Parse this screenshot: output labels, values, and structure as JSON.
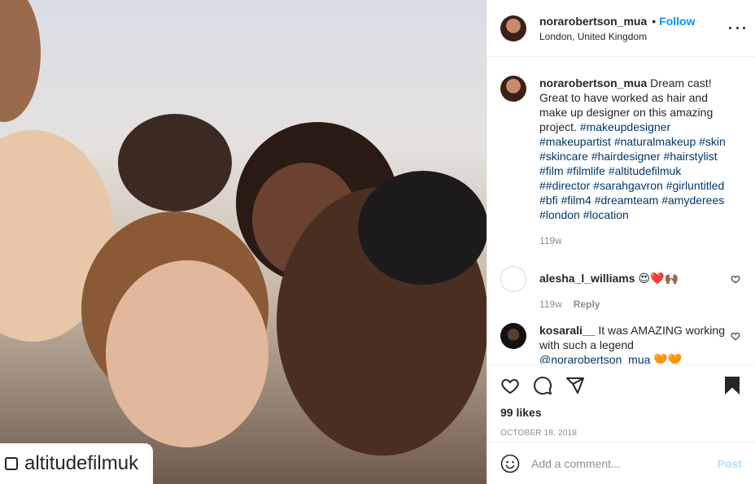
{
  "photo": {
    "repost_label": "altitudefilmuk"
  },
  "header": {
    "username": "norarobertson_mua",
    "separator": "•",
    "follow_label": "Follow",
    "location": "London, United Kingdom"
  },
  "caption": {
    "username": "norarobertson_mua",
    "text_intro": "Dream cast! Great to have worked as hair and make up designer on this amazing project.",
    "hashtags": [
      "#makeupdesigner",
      "#makeupartist",
      "#naturalmakeup",
      "#skin",
      "#skincare",
      "#hairdesigner",
      "#hairstylist",
      "#film",
      "#filmlife",
      "#altitudefilmuk",
      "##director",
      "#sarahgavron",
      "#girluntitled",
      "#bfi",
      "#film4",
      "#dreamteam",
      "#amyderees",
      "#london",
      "#location"
    ],
    "time": "119w"
  },
  "comments": [
    {
      "username": "alesha_l_williams",
      "text": "😍❤️🙌🏾",
      "time": "119w",
      "reply_label": "Reply"
    },
    {
      "username": "kosarali__",
      "text": "It was AMAZING working with such a legend",
      "mention": "@norarobertson_mua",
      "emoji": "🧡🧡"
    }
  ],
  "actions": {
    "likes": "99 likes",
    "date": "OCTOBER 18, 2018"
  },
  "add_comment": {
    "placeholder": "Add a comment...",
    "post_label": "Post"
  }
}
